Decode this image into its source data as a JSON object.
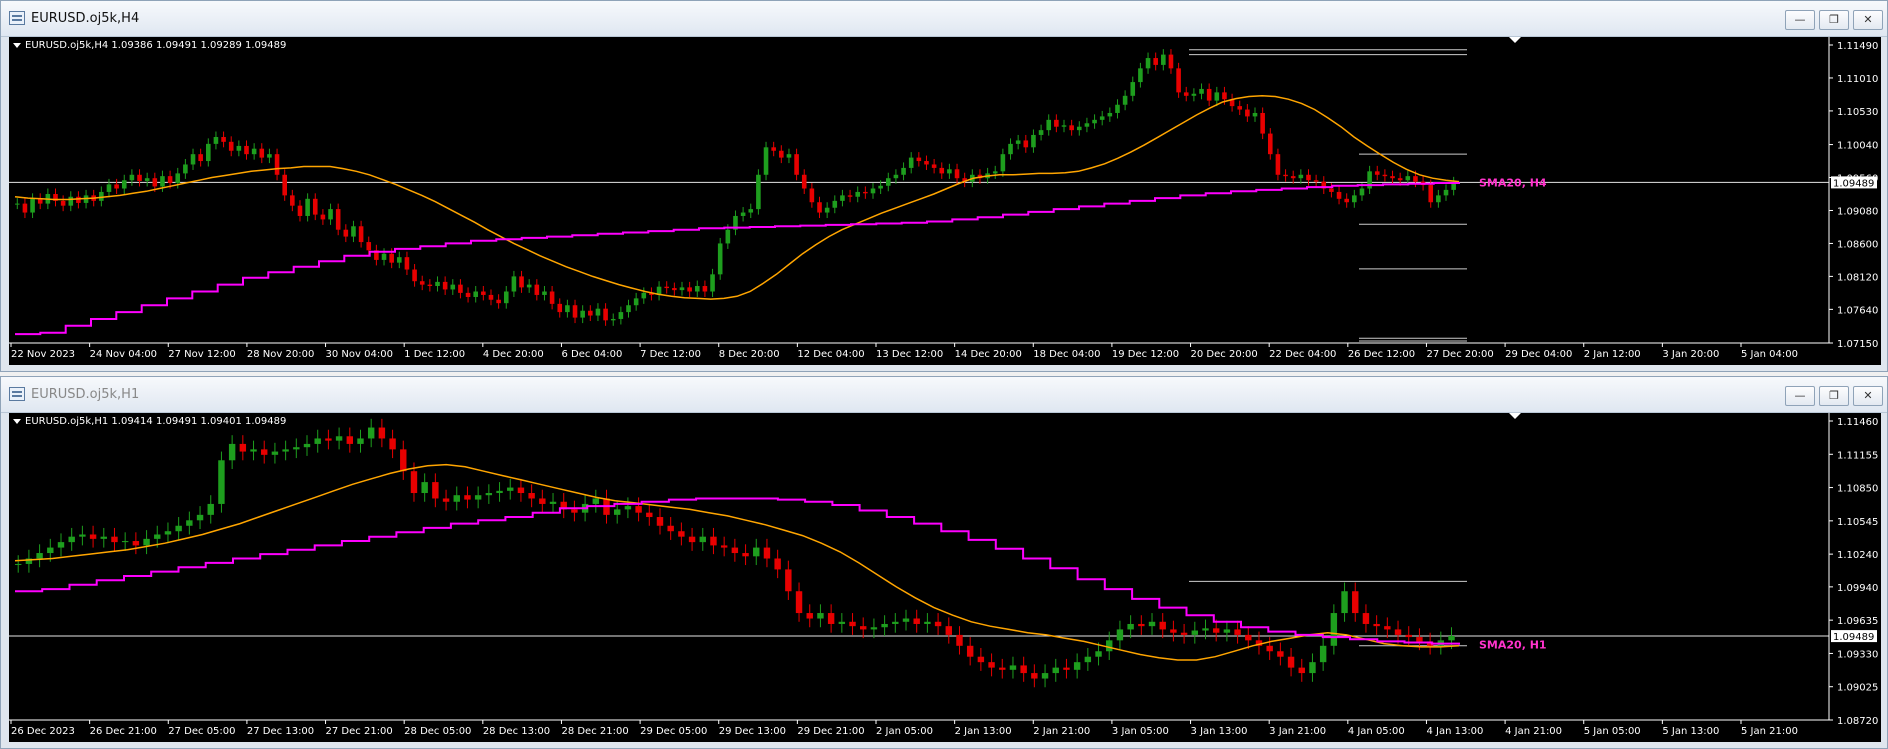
{
  "windows": [
    {
      "title": "EURUSD.oj5k,H4",
      "header": "EURUSD.oj5k,H4  1.09386 1.09491 1.09289 1.09489",
      "buttons": [
        "—",
        "❐",
        "✕"
      ]
    },
    {
      "title": "EURUSD.oj5k,H1",
      "header": "EURUSD.oj5k,H1  1.09414 1.09491 1.09401 1.09489",
      "buttons": [
        "—",
        "❐",
        "✕"
      ]
    }
  ],
  "chart_data": [
    {
      "type": "candlestick",
      "symbol": "EURUSD.oj5k",
      "timeframe": "H4",
      "ohlc": {
        "open": 1.09386,
        "high": 1.09491,
        "low": 1.09289,
        "close": 1.09489
      },
      "current_price": 1.09489,
      "current_price_label": "1.09489",
      "ylim": [
        1.0715,
        1.1149
      ],
      "y_ticks": [
        "1.11490",
        "1.11010",
        "1.10530",
        "1.10040",
        "1.09560",
        "1.09080",
        "1.08600",
        "1.08120",
        "1.07640",
        "1.07150"
      ],
      "x_ticks": [
        "22 Nov 2023",
        "24 Nov 04:00",
        "27 Nov 12:00",
        "28 Nov 20:00",
        "30 Nov 04:00",
        "1 Dec 12:00",
        "4 Dec 20:00",
        "6 Dec 04:00",
        "7 Dec 12:00",
        "8 Dec 20:00",
        "12 Dec 04:00",
        "13 Dec 12:00",
        "14 Dec 20:00",
        "18 Dec 04:00",
        "19 Dec 12:00",
        "20 Dec 20:00",
        "22 Dec 04:00",
        "26 Dec 12:00",
        "27 Dec 20:00",
        "29 Dec 04:00",
        "2 Jan 12:00",
        "3 Jan 20:00",
        "5 Jan 04:00"
      ],
      "sma_label": "SMA20, H4",
      "series_colors": {
        "up": "#1e9e1e",
        "down": "#e80000",
        "sma": "#ffa500",
        "htf_sma": "#ff00ff"
      },
      "series": [
        {
          "name": "price",
          "values": [
            1.0918,
            1.0905,
            1.0925,
            1.0918,
            1.0932,
            1.0922,
            1.0915,
            1.0928,
            1.0919,
            1.093,
            1.0922,
            1.0935,
            1.0946,
            1.094,
            1.0952,
            1.096,
            1.0951,
            1.0955,
            1.0943,
            1.0958,
            1.0948,
            1.0962,
            1.0975,
            1.099,
            1.098,
            1.1005,
            1.1015,
            1.1008,
            1.0995,
            1.1002,
            1.099,
            1.0998,
            1.0985,
            1.099,
            1.096,
            1.093,
            1.0915,
            1.09,
            1.0925,
            1.0902,
            1.0895,
            1.091,
            1.088,
            1.087,
            1.0885,
            1.0862,
            1.085,
            1.0836,
            1.0845,
            1.0832,
            1.084,
            1.0822,
            1.0805,
            1.08,
            1.0798,
            1.0804,
            1.0793,
            1.08,
            1.0788,
            1.0782,
            1.079,
            1.0785,
            1.0778,
            1.0773,
            1.079,
            1.0812,
            1.0796,
            1.08,
            1.0785,
            1.079,
            1.0772,
            1.076,
            1.077,
            1.0752,
            1.0762,
            1.0755,
            1.0765,
            1.0748,
            1.075,
            1.076,
            1.077,
            1.078,
            1.0788,
            1.0785,
            1.0797,
            1.0795,
            1.0792,
            1.0796,
            1.079,
            1.0798,
            1.079,
            1.0815,
            1.086,
            1.088,
            1.09,
            1.0905,
            1.091,
            1.096,
            1.1,
            1.0995,
            1.0985,
            1.099,
            1.096,
            1.094,
            1.092,
            1.0905,
            1.0912,
            1.0922,
            1.093,
            1.0928,
            1.0935,
            1.0933,
            1.094,
            1.0944,
            1.0955,
            1.096,
            1.097,
            1.0985,
            1.098,
            1.0975,
            1.097,
            1.0962,
            1.0968,
            1.0955,
            1.095,
            1.096,
            1.0955,
            1.0962,
            1.0965,
            1.099,
            1.1005,
            1.101,
            1.1,
            1.1018,
            1.1025,
            1.104,
            1.103,
            1.1032,
            1.1025,
            1.103,
            1.1035,
            1.104,
            1.1045,
            1.105,
            1.1062,
            1.1075,
            1.1095,
            1.1115,
            1.113,
            1.112,
            1.1135,
            1.1115,
            1.108,
            1.1075,
            1.1078,
            1.1085,
            1.1068,
            1.108,
            1.107,
            1.106,
            1.1055,
            1.1045,
            1.105,
            1.102,
            1.099,
            1.096,
            1.0958,
            1.0955,
            1.096,
            1.0952,
            1.095,
            1.094,
            1.0935,
            1.0925,
            1.092,
            1.093,
            1.094,
            1.0965,
            1.096,
            1.0958,
            1.0955,
            1.0952,
            1.0958,
            1.095,
            1.0945,
            1.092,
            1.093,
            1.0938,
            1.0949
          ]
        },
        {
          "name": "SMA20",
          "values": [
            1.0928,
            1.0926,
            1.0925,
            1.0924,
            1.0924,
            1.0925,
            1.0926,
            1.0928,
            1.093,
            1.0933,
            1.0936,
            1.094,
            1.0944,
            1.0948,
            1.0952,
            1.0956,
            1.0959,
            1.0962,
            1.0965,
            1.0967,
            1.0969,
            1.097,
            1.0972,
            1.0972,
            1.0972,
            1.0969,
            1.0965,
            1.096,
            1.0953,
            1.0946,
            1.0938,
            1.093,
            1.0921,
            1.0911,
            1.0901,
            1.0891,
            1.088,
            1.087,
            1.086,
            1.0851,
            1.0842,
            1.0834,
            1.0826,
            1.0819,
            1.0812,
            1.0806,
            1.08,
            1.0795,
            1.079,
            1.0786,
            1.0783,
            1.0781,
            1.078,
            1.0779,
            1.078,
            1.0783,
            1.079,
            1.0802,
            1.0815,
            1.083,
            1.0845,
            1.0858,
            1.087,
            1.088,
            1.0888,
            1.0896,
            1.0904,
            1.0911,
            1.0918,
            1.0925,
            1.0932,
            1.094,
            1.0948,
            1.0955,
            1.0958,
            1.096,
            1.096,
            1.0961,
            1.0962,
            1.0962,
            1.0963,
            1.0965,
            1.097,
            1.0976,
            1.0984,
            1.0993,
            1.1003,
            1.1014,
            1.1025,
            1.1036,
            1.1047,
            1.1057,
            1.1066,
            1.1071,
            1.1074,
            1.1075,
            1.1074,
            1.107,
            1.1064,
            1.1055,
            1.1043,
            1.103,
            1.1015,
            1.1002,
            1.099,
            1.0978,
            1.0968,
            1.096,
            1.0955,
            1.0952,
            1.095
          ]
        },
        {
          "name": "SMA20, H1",
          "values": [
            1.0728,
            1.073,
            1.074,
            1.075,
            1.076,
            1.077,
            1.078,
            1.079,
            1.08,
            1.081,
            1.0818,
            1.0826,
            1.0834,
            1.0842,
            1.0848,
            1.0852,
            1.0856,
            1.086,
            1.0864,
            1.0866,
            1.0868,
            1.087,
            1.0872,
            1.0874,
            1.0876,
            1.0878,
            1.088,
            1.0882,
            1.0883,
            1.0884,
            1.0885,
            1.0886,
            1.0887,
            1.0888,
            1.0889,
            1.089,
            1.0892,
            1.0895,
            1.0898,
            1.0902,
            1.0906,
            1.091,
            1.0914,
            1.0918,
            1.0922,
            1.0926,
            1.093,
            1.0933,
            1.0936,
            1.0938,
            1.094,
            1.0942,
            1.0944,
            1.0945,
            1.0946,
            1.0947,
            1.0948,
            1.0949
          ]
        }
      ],
      "levels": [
        1.1142,
        1.1135,
        1.099,
        1.0949,
        1.0888,
        1.0823,
        1.0722,
        1.0718
      ]
    },
    {
      "type": "candlestick",
      "symbol": "EURUSD.oj5k",
      "timeframe": "H1",
      "ohlc": {
        "open": 1.09414,
        "high": 1.09491,
        "low": 1.09401,
        "close": 1.09489
      },
      "current_price": 1.09489,
      "current_price_label": "1.09489",
      "ylim": [
        1.0872,
        1.1146
      ],
      "y_ticks": [
        "1.11460",
        "1.11155",
        "1.10850",
        "1.10545",
        "1.10240",
        "1.09940",
        "1.09635",
        "1.09330",
        "1.09025",
        "1.08720"
      ],
      "x_ticks": [
        "26 Dec 2023",
        "26 Dec 21:00",
        "27 Dec 05:00",
        "27 Dec 13:00",
        "27 Dec 21:00",
        "28 Dec 05:00",
        "28 Dec 13:00",
        "28 Dec 21:00",
        "29 Dec 05:00",
        "29 Dec 13:00",
        "29 Dec 21:00",
        "2 Jan 05:00",
        "2 Jan 13:00",
        "2 Jan 21:00",
        "3 Jan 05:00",
        "3 Jan 13:00",
        "3 Jan 21:00",
        "4 Jan 05:00",
        "4 Jan 13:00",
        "4 Jan 21:00",
        "5 Jan 05:00",
        "5 Jan 13:00",
        "5 Jan 21:00"
      ],
      "sma_label": "SMA20, H1",
      "series_colors": {
        "up": "#1e9e1e",
        "down": "#e80000",
        "sma": "#ffa500",
        "htf_sma": "#ff00ff"
      },
      "series": [
        {
          "name": "price",
          "values": [
            1.1015,
            1.102,
            1.1025,
            1.103,
            1.1035,
            1.104,
            1.1042,
            1.1038,
            1.104,
            1.1035,
            1.1036,
            1.1032,
            1.1038,
            1.1042,
            1.1045,
            1.105,
            1.1055,
            1.106,
            1.107,
            1.111,
            1.1125,
            1.1118,
            1.112,
            1.1115,
            1.1118,
            1.112,
            1.1122,
            1.1125,
            1.113,
            1.1128,
            1.1132,
            1.1125,
            1.113,
            1.114,
            1.113,
            1.112,
            1.11,
            1.108,
            1.109,
            1.1075,
            1.1072,
            1.1078,
            1.1074,
            1.1078,
            1.108,
            1.1082,
            1.1085,
            1.108,
            1.1075,
            1.107,
            1.1072,
            1.1065,
            1.1062,
            1.107,
            1.1075,
            1.106,
            1.1065,
            1.1068,
            1.1062,
            1.1058,
            1.105,
            1.1045,
            1.104,
            1.1035,
            1.104,
            1.1032,
            1.103,
            1.1025,
            1.1022,
            1.103,
            1.102,
            1.101,
            1.099,
            1.097,
            1.0965,
            1.097,
            1.096,
            1.0962,
            1.0958,
            1.0955,
            1.0957,
            1.096,
            1.0962,
            1.0965,
            1.096,
            1.0962,
            1.0958,
            1.095,
            1.094,
            1.093,
            1.0925,
            1.092,
            1.0918,
            1.0922,
            1.0915,
            1.091,
            1.0915,
            1.092,
            1.0918,
            1.0925,
            1.093,
            1.0935,
            1.0945,
            1.0955,
            1.096,
            1.0958,
            1.0962,
            1.0955,
            1.0952,
            1.095,
            1.0954,
            1.0956,
            1.0952,
            1.0955,
            1.095,
            1.0945,
            1.094,
            1.0935,
            1.093,
            1.092,
            1.0915,
            1.0925,
            1.094,
            1.097,
            1.099,
            1.097,
            1.096,
            1.0958,
            1.0955,
            1.095,
            1.0948,
            1.0944,
            1.094,
            1.0945,
            1.0949
          ]
        },
        {
          "name": "SMA20",
          "values": [
            1.1018,
            1.1019,
            1.102,
            1.1022,
            1.1024,
            1.1026,
            1.1028,
            1.1031,
            1.1034,
            1.1038,
            1.1042,
            1.1047,
            1.1052,
            1.1058,
            1.1064,
            1.107,
            1.1076,
            1.1082,
            1.1088,
            1.1093,
            1.1098,
            1.1102,
            1.1105,
            1.1106,
            1.1104,
            1.11,
            1.1096,
            1.1092,
            1.1088,
            1.1084,
            1.108,
            1.1076,
            1.1073,
            1.1071,
            1.1069,
            1.1067,
            1.1065,
            1.1062,
            1.1059,
            1.1055,
            1.1051,
            1.1046,
            1.1041,
            1.1034,
            1.1026,
            1.1016,
            1.1005,
            1.0994,
            1.0984,
            1.0975,
            1.0968,
            1.0962,
            1.0958,
            1.0955,
            1.0952,
            1.095,
            1.0947,
            1.0944,
            1.094,
            1.0936,
            1.0932,
            1.0929,
            1.0927,
            1.0927,
            1.093,
            1.0935,
            1.094,
            1.0944,
            1.0947,
            1.095,
            1.0952,
            1.095,
            1.0946,
            1.0942,
            1.094,
            1.0939,
            1.0939,
            1.094
          ]
        },
        {
          "name": "SMA20, H4",
          "values": [
            1.099,
            1.0992,
            1.0996,
            1.1,
            1.1004,
            1.1008,
            1.1012,
            1.1016,
            1.102,
            1.1024,
            1.1028,
            1.1032,
            1.1036,
            1.104,
            1.1044,
            1.1048,
            1.1052,
            1.1055,
            1.1058,
            1.1062,
            1.1066,
            1.1068,
            1.107,
            1.1072,
            1.1074,
            1.1075,
            1.1075,
            1.1075,
            1.1074,
            1.1072,
            1.1069,
            1.1064,
            1.1058,
            1.1052,
            1.1045,
            1.1037,
            1.1029,
            1.102,
            1.1011,
            1.1001,
            1.0992,
            1.0983,
            1.0975,
            1.0968,
            1.0962,
            1.0957,
            1.0953,
            1.095,
            1.0948,
            1.0946,
            1.0944,
            1.0943,
            1.0942,
            1.0941
          ]
        }
      ],
      "levels": [
        1.0999,
        1.0949,
        1.094
      ]
    }
  ]
}
